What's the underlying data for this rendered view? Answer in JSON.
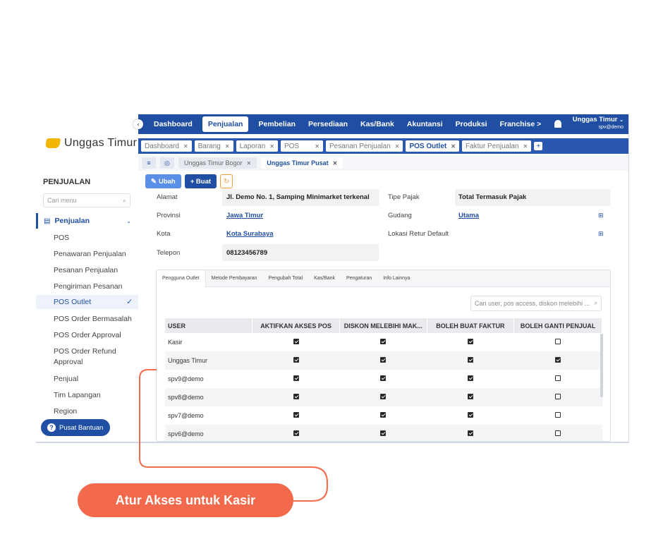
{
  "brand": {
    "name": "Unggas Timur"
  },
  "sidebar": {
    "section_title": "PENJUALAN",
    "search_placeholder": "Cari menu",
    "group_label": "Penjualan",
    "items": [
      {
        "label": "POS"
      },
      {
        "label": "Penawaran Penjualan"
      },
      {
        "label": "Pesanan Penjualan"
      },
      {
        "label": "Pengiriman Pesanan"
      },
      {
        "label": "POS Outlet",
        "active": true
      },
      {
        "label": "POS Order Bermasalah"
      },
      {
        "label": "POS Order Approval"
      },
      {
        "label": "POS Order Refund Approval"
      },
      {
        "label": "Penjual"
      },
      {
        "label": "Tim Lapangan"
      },
      {
        "label": "Region"
      }
    ],
    "help_label": "Pusat Bantuan"
  },
  "topnav": {
    "items": [
      "Dashboard",
      "Penjualan",
      "Pembelian",
      "Persediaan",
      "Kas/Bank",
      "Akuntansi",
      "Produksi",
      "Franchise >"
    ],
    "active": "Penjualan",
    "user_name": "Unggas Timur",
    "user_email": "spv@demo"
  },
  "tabs": [
    {
      "label": "Dashboard"
    },
    {
      "label": "Barang"
    },
    {
      "label": "Laporan"
    },
    {
      "label": "POS"
    },
    {
      "label": "Pesanan Penjualan"
    },
    {
      "label": "POS Outlet",
      "active": true
    },
    {
      "label": "Faktur Penjualan"
    }
  ],
  "subtabs": [
    {
      "label": "Unggas Timur Bogor"
    },
    {
      "label": "Unggas Timur Pusat",
      "active": true
    }
  ],
  "toolbar": {
    "edit_label": "Ubah",
    "create_label": "+ Buat"
  },
  "detail": {
    "alamat_label": "Alamat",
    "alamat_value": "Jl. Demo No. 1, Samping Minimarket terkenal",
    "provinsi_label": "Provinsi",
    "provinsi_value": "Jawa Timur",
    "kota_label": "Kota",
    "kota_value": "Kota Surabaya",
    "telepon_label": "Telepon",
    "telepon_value": "08123456789",
    "tipe_pajak_label": "Tipe Pajak",
    "tipe_pajak_value": "Total Termasuk Pajak",
    "gudang_label": "Gudang",
    "gudang_value": "Utama",
    "lokasi_label": "Lokasi Retur Default"
  },
  "panel": {
    "tabs": [
      "Pengguna Outlet",
      "Metode Pembayaran",
      "Pengubah Total",
      "Kas/Bank",
      "Pengaturan",
      "Info Lainnya"
    ],
    "search_placeholder": "Cari user, pos access, diskon melebihi ...",
    "columns": [
      "USER",
      "AKTIFKAN AKSES POS",
      "DISKON MELEBIHI MAK...",
      "BOLEH BUAT FAKTUR",
      "BOLEH GANTI PENJUAL"
    ],
    "rows": [
      {
        "user": "Kasir",
        "values": [
          true,
          true,
          true,
          false
        ]
      },
      {
        "user": "Unggas Timur",
        "values": [
          true,
          true,
          true,
          true
        ]
      },
      {
        "user": "spv9@demo",
        "values": [
          true,
          true,
          true,
          false
        ]
      },
      {
        "user": "spv8@demo",
        "values": [
          true,
          true,
          true,
          false
        ]
      },
      {
        "user": "spv7@demo",
        "values": [
          true,
          true,
          true,
          false
        ]
      },
      {
        "user": "spv6@demo",
        "values": [
          true,
          true,
          true,
          false
        ]
      }
    ]
  },
  "callout": {
    "text": "Atur Akses untuk Kasir",
    "color": "#f26a4b"
  },
  "colors": {
    "primary": "#1f4ea3",
    "accent": "#f26a4b"
  }
}
